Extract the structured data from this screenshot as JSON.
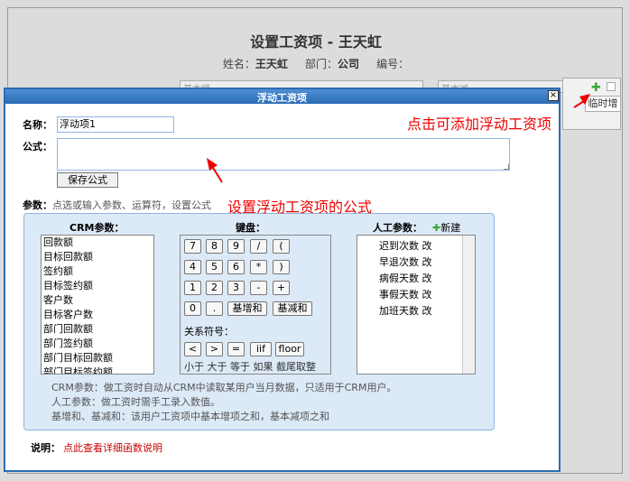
{
  "background_page": {
    "title": "设置工资项 - 王天虹",
    "name_label": "姓名：",
    "name_value": "王天虹",
    "dept_label": "部门：",
    "dept_value": "公司",
    "number_label": "编号：",
    "col_basic_inc": "基本增",
    "col_basic_dec": "基本减",
    "temp_inc_button": "临时增"
  },
  "dialog": {
    "title": "浮动工资项",
    "close_symbol": "×",
    "name_label": "名称：",
    "name_value": "浮动项1",
    "formula_label": "公式：",
    "formula_value": "",
    "save_button": "保存公式",
    "params_label": "参数：",
    "params_hint": "点选或输入参数、运算符，设置公式",
    "crm": {
      "title": "CRM参数：",
      "items": [
        "回款额",
        "目标回款额",
        "签约额",
        "目标签约额",
        "客户数",
        "目标客户数",
        "部门回款额",
        "部门签约额",
        "部门目标回款额",
        "部门目标签约额"
      ]
    },
    "keyboard": {
      "title": "键盘：",
      "rows": [
        [
          "7",
          "8",
          "9",
          "/",
          "("
        ],
        [
          "4",
          "5",
          "6",
          "*",
          ")"
        ],
        [
          "1",
          "2",
          "3",
          "-",
          "+"
        ],
        [
          "0",
          ".",
          "基增和",
          "基减和"
        ]
      ],
      "relation_label": "关系符号：",
      "relation_keys": [
        "<",
        ">",
        "=",
        "iif",
        "floor"
      ],
      "relation_hint": "小于 大于 等于 如果 截尾取整"
    },
    "manual": {
      "title": "人工参数：",
      "add_label": "新建",
      "items": [
        {
          "name": "迟到次数",
          "action": "改"
        },
        {
          "name": "早退次数",
          "action": "改"
        },
        {
          "name": "病假天数",
          "action": "改"
        },
        {
          "name": "事假天数",
          "action": "改"
        },
        {
          "name": "加班天数",
          "action": "改"
        }
      ]
    },
    "notes": [
      "CRM参数：做工资时自动从CRM中读取某用户当月数据，只适用于CRM用户。",
      "人工参数：做工资时需手工录入数值。",
      "基增和、基减和：该用户工资项中基本增项之和，基本减项之和"
    ],
    "desc_label": "说明：",
    "desc_link": "点此查看详细函数说明"
  },
  "annotations": {
    "formula": "设置浮动工资项的公式",
    "add": "点击可添加浮动工资项"
  },
  "colors": {
    "titlebar": "#2a6bb4",
    "panel_bg": "#dce9f7",
    "annotation": "#e00000",
    "link": "#cc0000",
    "add_icon": "#33aa33"
  }
}
